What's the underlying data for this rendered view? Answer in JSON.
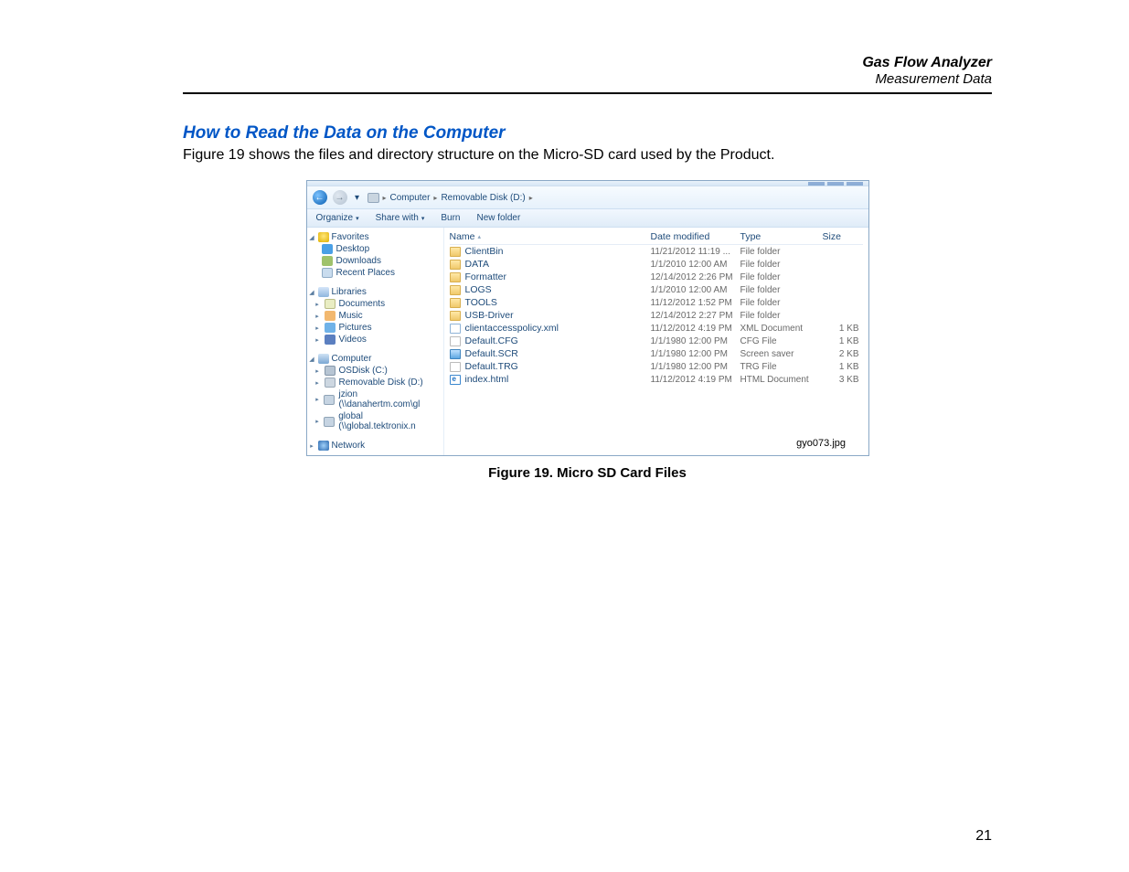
{
  "header": {
    "title": "Gas Flow Analyzer",
    "subtitle": "Measurement Data"
  },
  "section": {
    "title": "How to Read the Data on the Computer",
    "intro": "Figure 19 shows the files and directory structure on the Micro-SD card used by the Product."
  },
  "figure": {
    "caption": "Figure 19. Micro SD Card Files",
    "image_ref": "gyo073.jpg"
  },
  "page": {
    "number": "21"
  },
  "explorer": {
    "breadcrumb": {
      "root": "Computer",
      "folder": "Removable Disk (D:)"
    },
    "toolbar": {
      "organize": "Organize",
      "share": "Share with",
      "burn": "Burn",
      "newfolder": "New folder"
    },
    "columns": {
      "name": "Name",
      "date": "Date modified",
      "type": "Type",
      "size": "Size"
    },
    "nav": {
      "favorites": {
        "label": "Favorites",
        "items": [
          {
            "label": "Desktop",
            "ico": "desk"
          },
          {
            "label": "Downloads",
            "ico": "dl"
          },
          {
            "label": "Recent Places",
            "ico": "rp"
          }
        ]
      },
      "libraries": {
        "label": "Libraries",
        "items": [
          {
            "label": "Documents",
            "ico": "doc"
          },
          {
            "label": "Music",
            "ico": "mus"
          },
          {
            "label": "Pictures",
            "ico": "pic"
          },
          {
            "label": "Videos",
            "ico": "vid"
          }
        ]
      },
      "computer": {
        "label": "Computer",
        "items": [
          {
            "label": "OSDisk (C:)",
            "ico": "hdd"
          },
          {
            "label": "Removable Disk (D:)",
            "ico": "rem"
          },
          {
            "label": "jzion (\\\\danahertm.com\\gl",
            "ico": "netd"
          },
          {
            "label": "global (\\\\global.tektronix.n",
            "ico": "netd"
          }
        ]
      },
      "network": {
        "label": "Network"
      }
    },
    "files": [
      {
        "name": "ClientBin",
        "date": "11/21/2012 11:19 ...",
        "type": "File folder",
        "size": "",
        "ico": "folder"
      },
      {
        "name": "DATA",
        "date": "1/1/2010 12:00 AM",
        "type": "File folder",
        "size": "",
        "ico": "folder"
      },
      {
        "name": "Formatter",
        "date": "12/14/2012 2:26 PM",
        "type": "File folder",
        "size": "",
        "ico": "folder"
      },
      {
        "name": "LOGS",
        "date": "1/1/2010 12:00 AM",
        "type": "File folder",
        "size": "",
        "ico": "folder"
      },
      {
        "name": "TOOLS",
        "date": "11/12/2012 1:52 PM",
        "type": "File folder",
        "size": "",
        "ico": "folder"
      },
      {
        "name": "USB-Driver",
        "date": "12/14/2012 2:27 PM",
        "type": "File folder",
        "size": "",
        "ico": "folder"
      },
      {
        "name": "clientaccesspolicy.xml",
        "date": "11/12/2012 4:19 PM",
        "type": "XML Document",
        "size": "1 KB",
        "ico": "xml"
      },
      {
        "name": "Default.CFG",
        "date": "1/1/1980 12:00 PM",
        "type": "CFG File",
        "size": "1 KB",
        "ico": "cfg"
      },
      {
        "name": "Default.SCR",
        "date": "1/1/1980 12:00 PM",
        "type": "Screen saver",
        "size": "2 KB",
        "ico": "scr"
      },
      {
        "name": "Default.TRG",
        "date": "1/1/1980 12:00 PM",
        "type": "TRG File",
        "size": "1 KB",
        "ico": "trg"
      },
      {
        "name": "index.html",
        "date": "11/12/2012 4:19 PM",
        "type": "HTML Document",
        "size": "3 KB",
        "ico": "html"
      }
    ]
  }
}
